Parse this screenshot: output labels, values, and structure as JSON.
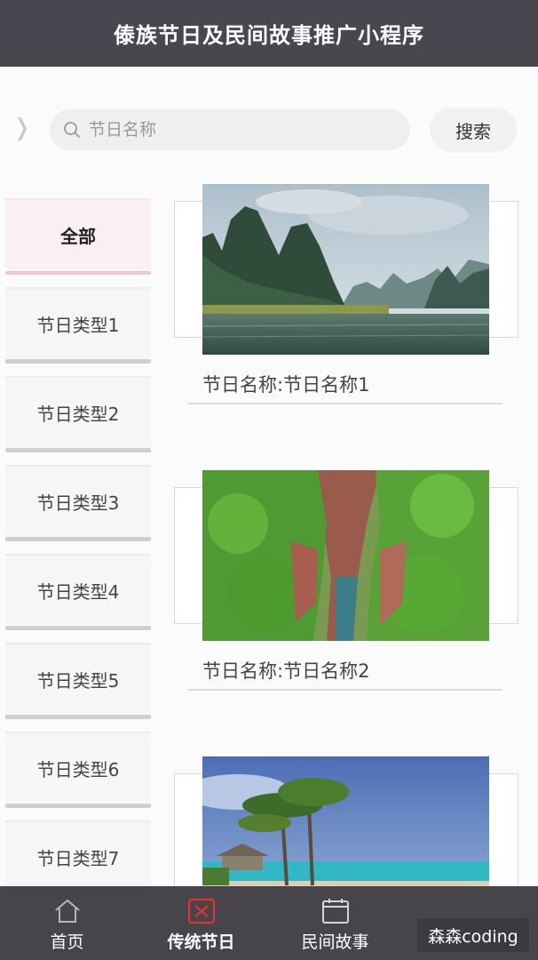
{
  "app": {
    "title": "傣族节日及民间故事推广小程序"
  },
  "search": {
    "placeholder": "节日名称",
    "button_label": "搜索",
    "back_icon": "chevron-right-icon"
  },
  "sidebar": {
    "items": [
      {
        "label": "全部",
        "active": true
      },
      {
        "label": "节日类型1"
      },
      {
        "label": "节日类型2"
      },
      {
        "label": "节日类型3"
      },
      {
        "label": "节日类型4"
      },
      {
        "label": "节日类型5"
      },
      {
        "label": "节日类型6"
      },
      {
        "label": "节日类型7"
      }
    ]
  },
  "festivals": [
    {
      "name": "节日名称:节日名称1",
      "image": "karst-river-landscape"
    },
    {
      "name": "节日名称:节日名称2",
      "image": "green-canyon"
    },
    {
      "name": "",
      "image": "palm-beach"
    }
  ],
  "tabbar": {
    "items": [
      {
        "label": "首页",
        "icon": "home-icon"
      },
      {
        "label": "传统节日",
        "icon": "festival-icon",
        "active": true
      },
      {
        "label": "民间故事",
        "icon": "calendar-icon"
      },
      {
        "label": "",
        "icon": ""
      }
    ],
    "active_color": "#e3332f"
  },
  "watermark": {
    "text": "森森coding"
  }
}
